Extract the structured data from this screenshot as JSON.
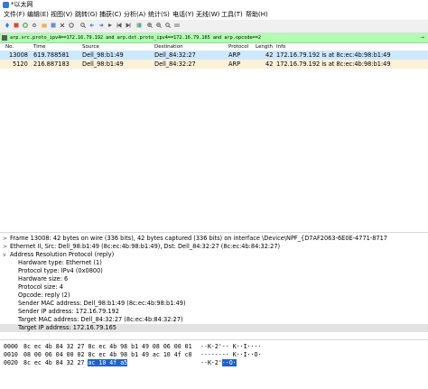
{
  "window": {
    "title": "*以太网"
  },
  "menu": [
    "文件(F)",
    "编辑(E)",
    "视图(V)",
    "跳转(G)",
    "捕获(C)",
    "分析(A)",
    "统计(S)",
    "电话(Y)",
    "无线(W)",
    "工具(T)",
    "帮助(H)"
  ],
  "filter": {
    "expression": "arp.src.proto_ipv4==172.16.79.192 and arp.dst.proto_ipv4==172.16.79.165 and arp.opcode==2"
  },
  "packet_list": {
    "columns": [
      "No.",
      "Time",
      "Source",
      "Destination",
      "Protocol",
      "Length",
      "Info"
    ],
    "rows": [
      {
        "no": "13008",
        "time": "619.788581",
        "source": "Dell_98:b1:49",
        "destination": "Dell_84:32:27",
        "protocol": "ARP",
        "length": "42",
        "info": "172.16.79.192 is at 8c:ec:4b:98:b1:49"
      },
      {
        "no": "5120",
        "time": "216.887183",
        "source": "Dell_98:b1:49",
        "destination": "Dell_84:32:27",
        "protocol": "ARP",
        "length": "42",
        "info": "172.16.79.192 is at 8c:ec:4b:98:b1:49"
      }
    ]
  },
  "details": [
    {
      "text": "Frame 13008: 42 bytes on wire (336 bits), 42 bytes captured (336 bits) on interface \\Device\\NPF_{D7AF2063-6E0E-4771-8717",
      "caret": ">",
      "level": 0
    },
    {
      "text": "Ethernet II, Src: Dell_98:b1:49 (8c:ec:4b:98:b1:49), Dst: Dell_84:32:27 (8c:ec:4b:84:32:27)",
      "caret": ">",
      "level": 0
    },
    {
      "text": "Address Resolution Protocol (reply)",
      "caret": "v",
      "level": 0
    },
    {
      "text": "Hardware type: Ethernet (1)",
      "caret": "",
      "level": 1
    },
    {
      "text": "Protocol type: IPv4 (0x0800)",
      "caret": "",
      "level": 1
    },
    {
      "text": "Hardware size: 6",
      "caret": "",
      "level": 1
    },
    {
      "text": "Protocol size: 4",
      "caret": "",
      "level": 1
    },
    {
      "text": "Opcode: reply (2)",
      "caret": "",
      "level": 1
    },
    {
      "text": "Sender MAC address: Dell_98:b1:49 (8c:ec:4b:98:b1:49)",
      "caret": "",
      "level": 1
    },
    {
      "text": "Sender IP address: 172.16.79.192",
      "caret": "",
      "level": 1
    },
    {
      "text": "Target MAC address: Dell_84:32:27 (8c:ec:4b:84:32:27)",
      "caret": "",
      "level": 1
    },
    {
      "text": "Target IP address: 172.16.79.165",
      "caret": "",
      "level": 1
    }
  ],
  "hex": {
    "line0": {
      "offset": "0000",
      "bytes": "8c ec 4b 84 32 27 8c ec  4b 98 b1 49 08 06 00 01",
      "ascii": "··K·2'·· K··I····"
    },
    "line1": {
      "offset": "0010",
      "bytes": "08 00 06 04 00 02 8c ec  4b 98 b1 49 ac 10 4f c0",
      "ascii": "········ K··I··O·"
    },
    "line2": {
      "offset": "0020",
      "bytes_plain": "8c ec 4b 84 32 27 ",
      "bytes_sel": "ac 10  4f a5",
      "ascii_plain": "··K·2'",
      "ascii_sel": "··O·"
    }
  }
}
